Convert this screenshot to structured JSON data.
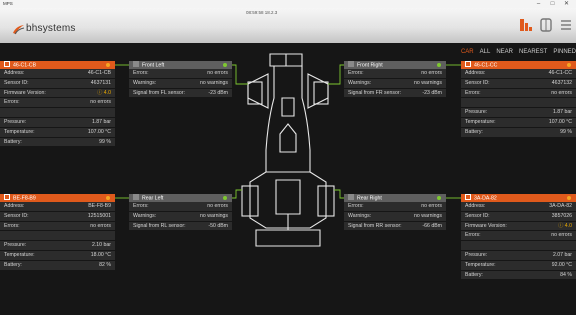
{
  "window": {
    "app_name": "MPS",
    "clock": "08:59:58 18.2.3",
    "minimize": "–",
    "maximize": "□",
    "close": "✕"
  },
  "header": {
    "logo_text": "bhsystems",
    "icons": [
      "sort-icon",
      "tire-icon",
      "menu-icon"
    ]
  },
  "sortbar": {
    "items": [
      "CAR",
      "ALL",
      "NEAR",
      "NEAREST",
      "PINNED"
    ],
    "active": "CAR"
  },
  "colors": {
    "accent": "#e05a1c",
    "ok": "#7ec830",
    "warn": "#e8a800"
  },
  "sensors": {
    "fl": {
      "title": "46-C1-CB",
      "status": "connected",
      "rows": [
        {
          "label": "Address:",
          "value": "46-C1-CB"
        },
        {
          "label": "Sensor ID:",
          "value": "4637131"
        },
        {
          "label": "Firmware Version:",
          "value": "4.0",
          "warn": "ⓘ"
        },
        {
          "label": "Errors:",
          "value": "no errors"
        },
        {
          "label": "",
          "value": ""
        },
        {
          "label": "Pressure:",
          "value": "1.87 bar"
        },
        {
          "label": "Temperature:",
          "value": "107.00 °C"
        },
        {
          "label": "Battery:",
          "value": "99 %"
        }
      ]
    },
    "fr": {
      "title": "46-C1-CC",
      "status": "connected",
      "rows": [
        {
          "label": "Address:",
          "value": "46-C1-CC"
        },
        {
          "label": "Sensor ID:",
          "value": "4637132"
        },
        {
          "label": "Errors:",
          "value": "no errors"
        },
        {
          "label": "",
          "value": ""
        },
        {
          "label": "Pressure:",
          "value": "1.87 bar"
        },
        {
          "label": "Temperature:",
          "value": "107.00 °C"
        },
        {
          "label": "Battery:",
          "value": "99 %"
        }
      ]
    },
    "rl": {
      "title": "BE-F8-B9",
      "status": "connected",
      "rows": [
        {
          "label": "Address:",
          "value": "BE-F8-B9"
        },
        {
          "label": "Sensor ID:",
          "value": "12515001"
        },
        {
          "label": "Errors:",
          "value": "no errors"
        },
        {
          "label": "",
          "value": ""
        },
        {
          "label": "Pressure:",
          "value": "2.10 bar"
        },
        {
          "label": "Temperature:",
          "value": "18.00 °C"
        },
        {
          "label": "Battery:",
          "value": "82 %"
        }
      ]
    },
    "rr": {
      "title": "3A-DA-82",
      "status": "connected",
      "rows": [
        {
          "label": "Address:",
          "value": "3A-DA-82"
        },
        {
          "label": "Sensor ID:",
          "value": "3857026"
        },
        {
          "label": "Firmware Version:",
          "value": "4.0",
          "warn": "ⓘ"
        },
        {
          "label": "Errors:",
          "value": "no errors"
        },
        {
          "label": "",
          "value": ""
        },
        {
          "label": "Pressure:",
          "value": "2.07 bar"
        },
        {
          "label": "Temperature:",
          "value": "92.00 °C"
        },
        {
          "label": "Battery:",
          "value": "84 %"
        }
      ]
    }
  },
  "receivers": {
    "fl": {
      "title": "Front Left",
      "rows": [
        {
          "label": "Errors:",
          "value": "no errors"
        },
        {
          "label": "Warnings:",
          "value": "no warnings"
        },
        {
          "label": "Signal from FL sensor:",
          "value": "-23 dBm"
        }
      ]
    },
    "fr": {
      "title": "Front Right",
      "rows": [
        {
          "label": "Errors:",
          "value": "no errors"
        },
        {
          "label": "Warnings:",
          "value": "no warnings"
        },
        {
          "label": "Signal from FR sensor:",
          "value": "-23 dBm"
        }
      ]
    },
    "rl": {
      "title": "Rear Left",
      "rows": [
        {
          "label": "Errors:",
          "value": "no errors"
        },
        {
          "label": "Warnings:",
          "value": "no warnings"
        },
        {
          "label": "Signal from RL sensor:",
          "value": "-50 dBm"
        }
      ]
    },
    "rr": {
      "title": "Rear Right",
      "rows": [
        {
          "label": "Errors:",
          "value": "no errors"
        },
        {
          "label": "Warnings:",
          "value": "no warnings"
        },
        {
          "label": "Signal from RR sensor:",
          "value": "-66 dBm"
        }
      ]
    }
  }
}
